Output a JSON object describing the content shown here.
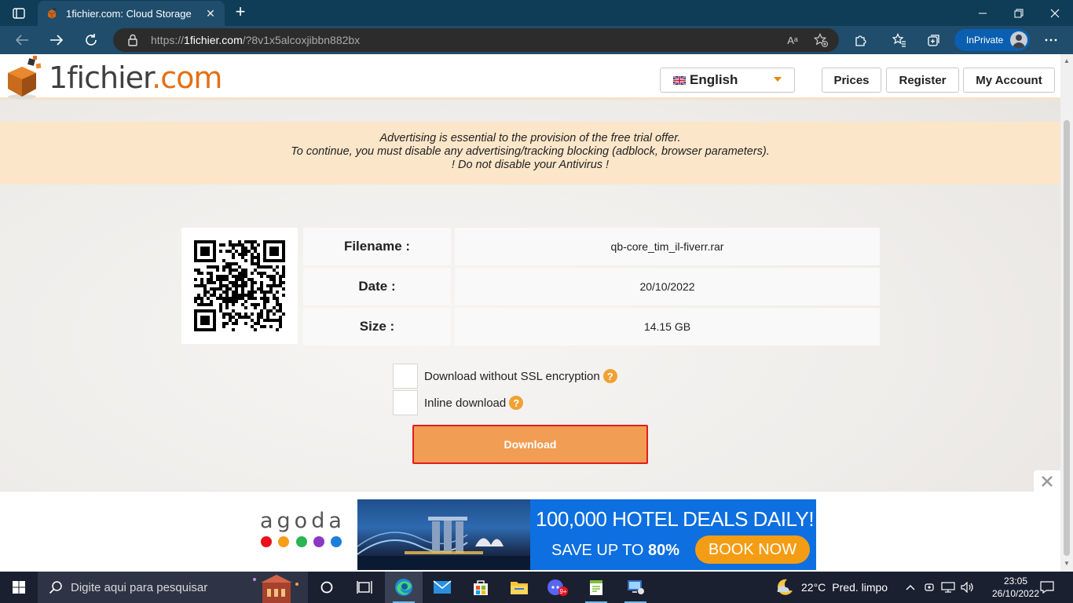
{
  "browser": {
    "tab_title": "1fichier.com: Cloud Storage",
    "url_prefix": "https://",
    "url_host": "1fichier.com",
    "url_path": "/?8v1x5alcoxjibbn882bx",
    "read_aloud_label": "Aᵃ",
    "inprivate_label": "InPrivate"
  },
  "site": {
    "logo_part1": "1fichier",
    "logo_part2": ".com",
    "language": "English",
    "nav": {
      "prices": "Prices",
      "register": "Register",
      "account": "My Account"
    }
  },
  "notice": {
    "line1": "Advertising is essential to the provision of the free trial offer.",
    "line2": "To continue, you must disable any advertising/tracking blocking (adblock, browser parameters).",
    "line3": "! Do not disable your Antivirus !"
  },
  "file": {
    "filename_label": "Filename :",
    "filename": "qb-core_tim_il-fiverr.rar",
    "date_label": "Date :",
    "date": "20/10/2022",
    "size_label": "Size :",
    "size": "14.15 GB"
  },
  "options": {
    "no_ssl": "Download without SSL encryption",
    "inline": "Inline download",
    "help": "?"
  },
  "download_label": "Download",
  "ad": {
    "brand": "agoda",
    "headline": "100,000 HOTEL DEALS DAILY!",
    "sub_prefix": "SAVE UP TO ",
    "sub_value": "80%",
    "cta": "BOOK NOW",
    "dot_colors": [
      "#e8111c",
      "#f89d1a",
      "#2bb553",
      "#8a38c4",
      "#1b7ed8"
    ]
  },
  "taskbar": {
    "search_placeholder": "Digite aqui para pesquisar",
    "temperature": "22°C",
    "forecast": "Pred. limpo",
    "time": "23:05",
    "date": "26/10/2022",
    "chat_badge": "9+"
  },
  "colors": {
    "brand_orange": "#e46f14",
    "download_button": "#f19d54",
    "browser_frame": "#1f4d6b"
  }
}
